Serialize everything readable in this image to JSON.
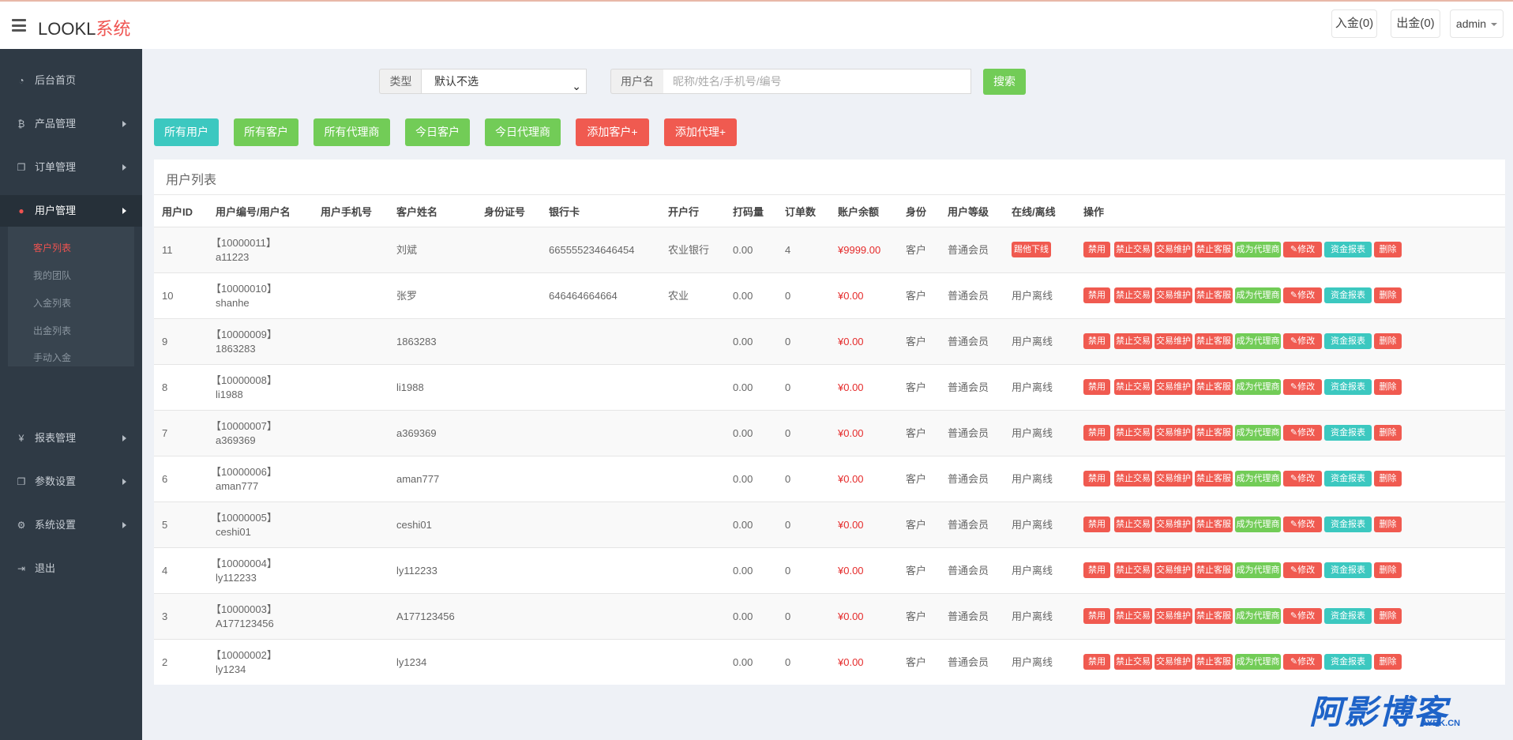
{
  "app": {
    "logo_main": "LOOKL",
    "logo_accent": "系统"
  },
  "topbar": {
    "deposit": "入金(0)",
    "withdraw": "出金(0)",
    "user": "admin"
  },
  "sidebar": {
    "items": [
      {
        "label": "后台首页",
        "icon": "dashboard-icon"
      },
      {
        "label": "产品管理",
        "icon": "bitcoin-icon"
      },
      {
        "label": "订单管理",
        "icon": "copy-icon"
      },
      {
        "label": "用户管理",
        "icon": "user-icon"
      },
      {
        "label": "报表管理",
        "icon": "yen-icon"
      },
      {
        "label": "参数设置",
        "icon": "copy-icon"
      },
      {
        "label": "系统设置",
        "icon": "gears-icon"
      },
      {
        "label": "退出",
        "icon": "sign-out-icon"
      }
    ],
    "sub_items": [
      "客户列表",
      "我的团队",
      "入金列表",
      "出金列表",
      "手动入金"
    ]
  },
  "search": {
    "type_label": "类型",
    "type_value": "默认不选",
    "name_label": "用户名",
    "name_placeholder": "昵称/姓名/手机号/编号",
    "name_value": "",
    "button": "搜索"
  },
  "filters": [
    "所有用户",
    "所有客户",
    "所有代理商",
    "今日客户",
    "今日代理商",
    "添加客户+",
    "添加代理+"
  ],
  "panel": {
    "title": "用户列表"
  },
  "table": {
    "headers": [
      "用户ID",
      "用户编号/用户名",
      "用户手机号",
      "客户姓名",
      "身份证号",
      "银行卡",
      "开户行",
      "打码量",
      "订单数",
      "账户余额",
      "身份",
      "用户等级",
      "在线/离线",
      "操作"
    ],
    "actions": [
      "禁用",
      "禁止交易",
      "交易维护",
      "禁止客服",
      "成为代理商",
      "修改",
      "资金报表",
      "删除"
    ],
    "rows": [
      {
        "id": "11",
        "code": "【10000011】",
        "username": "a11223",
        "phone": "",
        "name": "刘斌",
        "idcard": "",
        "bank_card": "665555234646454",
        "bank": "农业银行",
        "bet": "0.00",
        "orders": "4",
        "balance": "¥9999.00",
        "role": "客户",
        "level": "普通会员",
        "online": "踢他下线"
      },
      {
        "id": "10",
        "code": "【10000010】",
        "username": "shanhe",
        "phone": "",
        "name": "张罗",
        "idcard": "",
        "bank_card": "646464664664",
        "bank": "农业",
        "bet": "0.00",
        "orders": "0",
        "balance": "¥0.00",
        "role": "客户",
        "level": "普通会员",
        "online": "用户离线"
      },
      {
        "id": "9",
        "code": "【10000009】",
        "username": "1863283",
        "phone": "",
        "name": "1863283",
        "idcard": "",
        "bank_card": "",
        "bank": "",
        "bet": "0.00",
        "orders": "0",
        "balance": "¥0.00",
        "role": "客户",
        "level": "普通会员",
        "online": "用户离线"
      },
      {
        "id": "8",
        "code": "【10000008】",
        "username": "li1988",
        "phone": "",
        "name": "li1988",
        "idcard": "",
        "bank_card": "",
        "bank": "",
        "bet": "0.00",
        "orders": "0",
        "balance": "¥0.00",
        "role": "客户",
        "level": "普通会员",
        "online": "用户离线"
      },
      {
        "id": "7",
        "code": "【10000007】",
        "username": "a369369",
        "phone": "",
        "name": "a369369",
        "idcard": "",
        "bank_card": "",
        "bank": "",
        "bet": "0.00",
        "orders": "0",
        "balance": "¥0.00",
        "role": "客户",
        "level": "普通会员",
        "online": "用户离线"
      },
      {
        "id": "6",
        "code": "【10000006】",
        "username": "aman777",
        "phone": "",
        "name": "aman777",
        "idcard": "",
        "bank_card": "",
        "bank": "",
        "bet": "0.00",
        "orders": "0",
        "balance": "¥0.00",
        "role": "客户",
        "level": "普通会员",
        "online": "用户离线"
      },
      {
        "id": "5",
        "code": "【10000005】",
        "username": "ceshi01",
        "phone": "",
        "name": "ceshi01",
        "idcard": "",
        "bank_card": "",
        "bank": "",
        "bet": "0.00",
        "orders": "0",
        "balance": "¥0.00",
        "role": "客户",
        "level": "普通会员",
        "online": "用户离线"
      },
      {
        "id": "4",
        "code": "【10000004】",
        "username": "ly112233",
        "phone": "",
        "name": "ly112233",
        "idcard": "",
        "bank_card": "",
        "bank": "",
        "bet": "0.00",
        "orders": "0",
        "balance": "¥0.00",
        "role": "客户",
        "level": "普通会员",
        "online": "用户离线"
      },
      {
        "id": "3",
        "code": "【10000003】",
        "username": "A177123456",
        "phone": "",
        "name": "A177123456",
        "idcard": "",
        "bank_card": "",
        "bank": "",
        "bet": "0.00",
        "orders": "0",
        "balance": "¥0.00",
        "role": "客户",
        "level": "普通会员",
        "online": "用户离线"
      },
      {
        "id": "2",
        "code": "【10000002】",
        "username": "ly1234",
        "phone": "",
        "name": "ly1234",
        "idcard": "",
        "bank_card": "",
        "bank": "",
        "bet": "0.00",
        "orders": "0",
        "balance": "¥0.00",
        "role": "客户",
        "level": "普通会员",
        "online": "用户离线"
      }
    ]
  },
  "watermark": {
    "big": "阿影博客",
    "small": "AYBK.CN"
  },
  "colors": {
    "sidebar": "#2f3a45",
    "accent_red": "#f05a50",
    "green": "#72cc57",
    "teal": "#3cc8c0",
    "balance_red": "#e52b2b"
  }
}
